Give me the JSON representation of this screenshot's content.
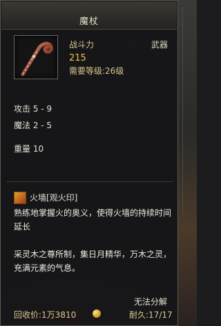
{
  "item": {
    "name": "魔杖",
    "power_label": "战斗力",
    "power_value": "215",
    "required_level": "需要等级:26级",
    "type": "武器",
    "icon": "staff-icon"
  },
  "stats": {
    "attack": "攻击 5 - 9",
    "magic": "魔法 2 - 5",
    "weight": "重量 10"
  },
  "skill": {
    "icon": "fire-wall-icon",
    "name": "火墙[观火印]",
    "description": "熟练地掌握火的奥义，使得火墙的持续时间延长"
  },
  "lore": "采灵木之尊所制，集日月精华，万木之灵，充满元素的气息。",
  "footer": {
    "cannot_decompose": "无法分解",
    "recycle_price": "回收价:1万3810",
    "durability": "耐久:17/17"
  },
  "colors": {
    "gold": "#e9c24a",
    "label": "#d8c890",
    "text": "#e6e1d4",
    "border": "#5c5a52"
  }
}
